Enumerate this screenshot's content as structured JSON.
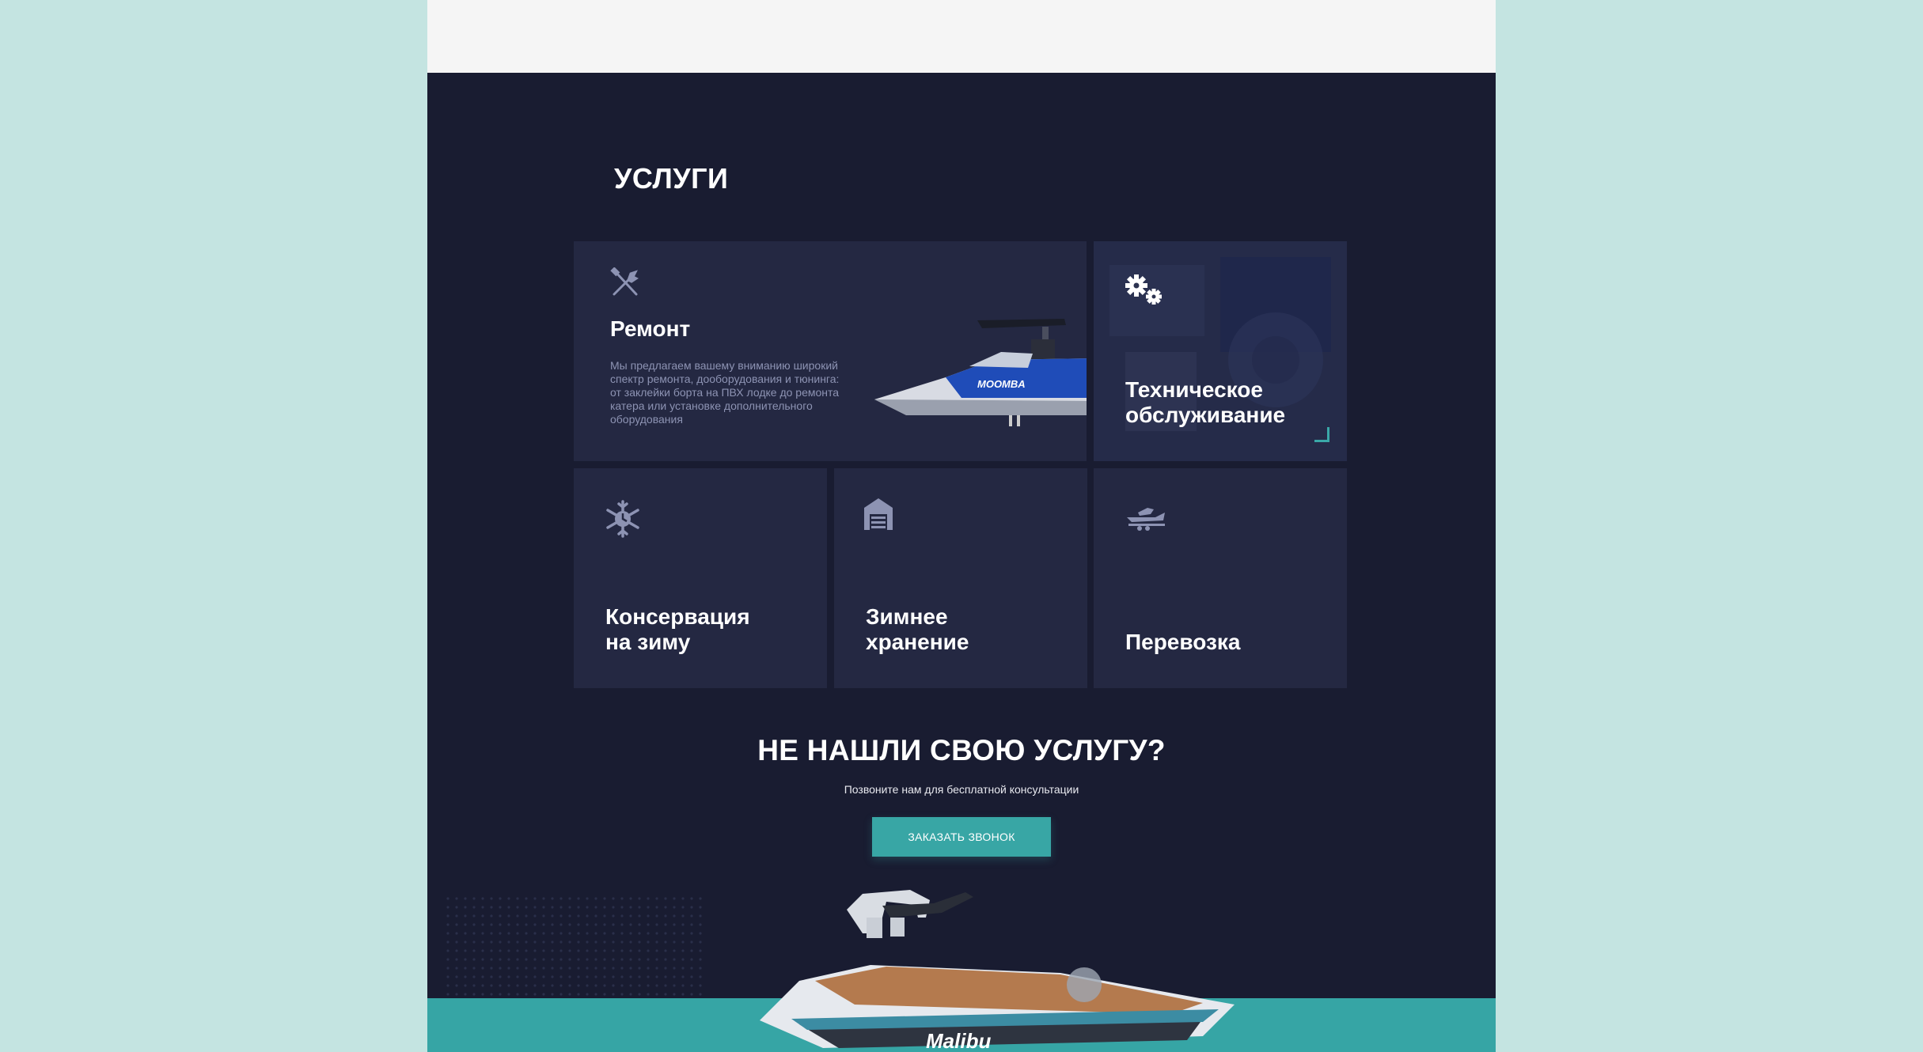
{
  "section": {
    "title": "УСЛУГИ"
  },
  "services": {
    "repair": {
      "title": "Ремонт",
      "description": "Мы предлагаем вашему вниманию широкий спектр ремонта, дооборудования и тюнинга: от заклейки борта на ПВХ лодке до ремонта катера или установке дополнительного оборудования",
      "boat_brand": "MOOMBA",
      "icon": "wrench-screwdriver-icon"
    },
    "maintenance": {
      "title_line1": "Техническое",
      "title_line2": "обслуживание",
      "icon": "gears-icon"
    },
    "winterization": {
      "title_line1": "Консервация",
      "title_line2": "на зиму",
      "icon": "snowflake-clock-icon"
    },
    "storage": {
      "title_line1": "Зимнее",
      "title_line2": "хранение",
      "icon": "garage-icon"
    },
    "transport": {
      "title": "Перевозка",
      "icon": "boat-trailer-icon"
    }
  },
  "cta": {
    "title": "НЕ НАШЛИ СВОЮ УСЛУГУ?",
    "subtitle": "Позвоните нам для бесплатной консультации",
    "button_label": "ЗАКАЗАТЬ ЗВОНОК"
  },
  "footer_boat": {
    "brand": "Malibu"
  },
  "colors": {
    "background": "#c4e4e1",
    "page_dark": "#191c31",
    "card": "#242842",
    "accent": "#38a6a5",
    "icon": "#8d93b3"
  }
}
